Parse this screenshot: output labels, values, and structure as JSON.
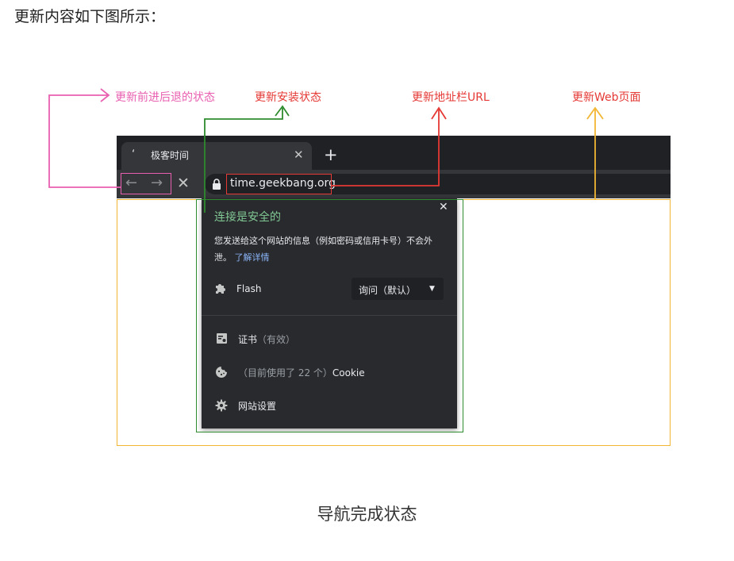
{
  "heading": "更新内容如下图所示：",
  "caption": "导航完成状态",
  "annotations": {
    "nav_state": "更新前进后退的状态",
    "security_state": "更新安装状态",
    "address_bar": "更新地址栏URL",
    "web_page": "更新Web页面"
  },
  "colors": {
    "nav_state": "#e95fb0",
    "security_state": "#2e8b2e",
    "address_bar": "#e53935",
    "web_page": "#f2b632"
  },
  "browser": {
    "tab": {
      "favicon": "ʻ",
      "title": "极客时间",
      "close": "✕",
      "new_tab": "+"
    },
    "toolbar": {
      "back": "←",
      "forward": "→",
      "stop": "✕",
      "url": "time.geekbang.org"
    }
  },
  "site_info_popup": {
    "close": "✕",
    "title": "连接是安全的",
    "description": "您发送给这个网站的信息（例如密码或信用卡号）不会外泄。",
    "learn_more": "了解详情",
    "flash": {
      "label": "Flash",
      "select_value": "询问（默认）",
      "select_arrow": "▼"
    },
    "certificate": {
      "label": "证书",
      "status": "（有效）"
    },
    "cookies": {
      "prefix": "（目前使用了 22 个）",
      "label": "Cookie"
    },
    "site_settings": "网站设置"
  },
  "icons": [
    "lock-icon",
    "puzzle-icon",
    "certificate-icon",
    "cookie-icon",
    "gear-icon"
  ]
}
